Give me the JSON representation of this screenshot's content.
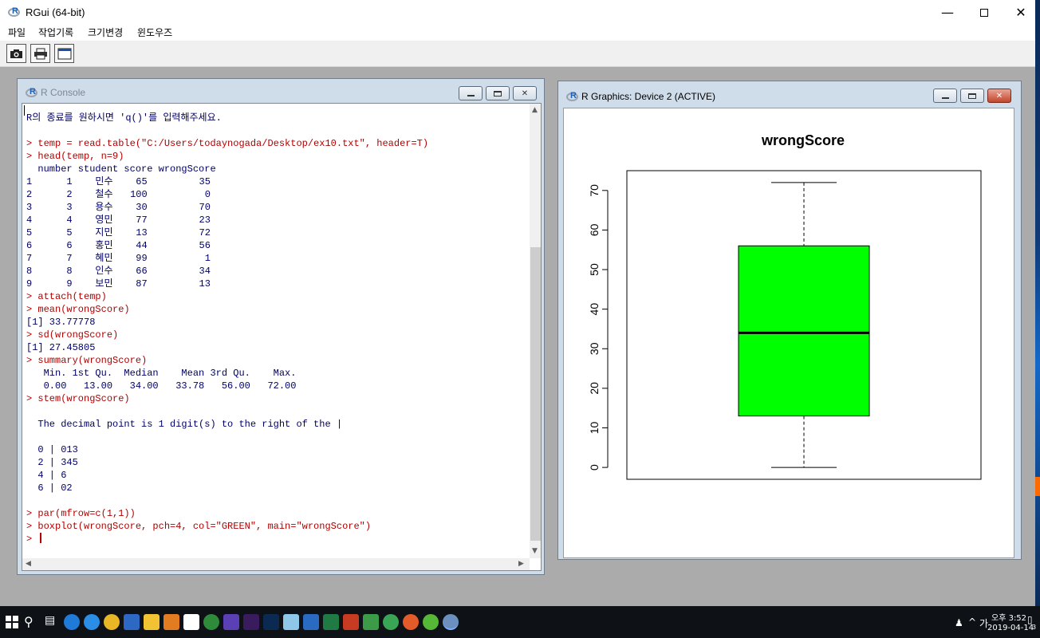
{
  "app": {
    "title": "RGui (64-bit)",
    "menu": [
      "파일",
      "작업기록",
      "크기변경",
      "윈도우즈"
    ],
    "toolbar_icons": [
      "camera-icon",
      "printer-icon",
      "window-icon"
    ]
  },
  "console": {
    "title": "R Console",
    "lines": [
      {
        "text": "R의 종료를 원하시면 'q()'를 입력해주세요.",
        "kind": "out"
      },
      {
        "text": "",
        "kind": "out"
      },
      {
        "text": "> temp = read.table(\"C:/Users/todaynogada/Desktop/ex10.txt\", header=T)",
        "kind": "cmd"
      },
      {
        "text": "> head(temp, n=9)",
        "kind": "cmd"
      },
      {
        "text": "  number student score wrongScore",
        "kind": "out"
      },
      {
        "text": "1      1    민수    65         35",
        "kind": "out"
      },
      {
        "text": "2      2    철수   100          0",
        "kind": "out"
      },
      {
        "text": "3      3    용수    30         70",
        "kind": "out"
      },
      {
        "text": "4      4    영민    77         23",
        "kind": "out"
      },
      {
        "text": "5      5    지민    13         72",
        "kind": "out"
      },
      {
        "text": "6      6    홍민    44         56",
        "kind": "out"
      },
      {
        "text": "7      7    혜민    99          1",
        "kind": "out"
      },
      {
        "text": "8      8    인수    66         34",
        "kind": "out"
      },
      {
        "text": "9      9    보민    87         13",
        "kind": "out"
      },
      {
        "text": "> attach(temp)",
        "kind": "cmd"
      },
      {
        "text": "> mean(wrongScore)",
        "kind": "cmd"
      },
      {
        "text": "[1] 33.77778",
        "kind": "out"
      },
      {
        "text": "> sd(wrongScore)",
        "kind": "cmd"
      },
      {
        "text": "[1] 27.45805",
        "kind": "out"
      },
      {
        "text": "> summary(wrongScore)",
        "kind": "cmd"
      },
      {
        "text": "   Min. 1st Qu.  Median    Mean 3rd Qu.    Max. ",
        "kind": "out"
      },
      {
        "text": "   0.00   13.00   34.00   33.78   56.00   72.00 ",
        "kind": "out"
      },
      {
        "text": "> stem(wrongScore)",
        "kind": "cmd"
      },
      {
        "text": "",
        "kind": "out"
      },
      {
        "text": "  The decimal point is 1 digit(s) to the right of the |",
        "kind": "out"
      },
      {
        "text": "",
        "kind": "out"
      },
      {
        "text": "  0 | 013",
        "kind": "out"
      },
      {
        "text": "  2 | 345",
        "kind": "out"
      },
      {
        "text": "  4 | 6",
        "kind": "out"
      },
      {
        "text": "  6 | 02",
        "kind": "out"
      },
      {
        "text": "",
        "kind": "out"
      },
      {
        "text": "> par(mfrow=c(1,1))",
        "kind": "cmd"
      },
      {
        "text": "> boxplot(wrongScore, pch=4, col=\"GREEN\", main=\"wrongScore\")",
        "kind": "cmd"
      },
      {
        "text": "> ",
        "kind": "cmd"
      }
    ]
  },
  "graphics": {
    "title": "R Graphics: Device 2 (ACTIVE)"
  },
  "chart_data": {
    "type": "box",
    "title": "wrongScore",
    "xlabel": "",
    "ylabel": "",
    "ylim": [
      -3,
      75
    ],
    "yticks": [
      0,
      10,
      20,
      30,
      40,
      50,
      60,
      70
    ],
    "box": {
      "min": 0,
      "q1": 13,
      "median": 34,
      "q3": 56,
      "max": 72
    },
    "fill": "#00ff00",
    "grid": false
  },
  "taskbar": {
    "time": "오후 3:52",
    "date": "2019-04-14",
    "ime": "가",
    "notifications": "3"
  },
  "colors": {
    "cmd": "#b30000",
    "out": "#000066",
    "box_fill": "#00ff00"
  }
}
